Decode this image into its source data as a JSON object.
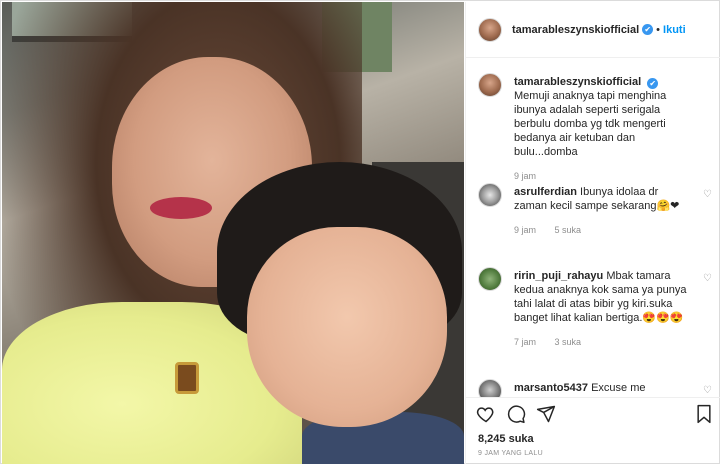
{
  "post": {
    "username": "tamarableszynskiofficial",
    "follow_label": "Ikuti",
    "separator": "•",
    "verified_mark": "✔"
  },
  "comments": [
    {
      "username": "tamarableszynskiofficial",
      "text": "Memuji anaknya tapi menghina ibunya adalah seperti serigala berbulu domba yg tdk mengerti bedanya air ketuban dan bulu...domba",
      "age": "9 jam",
      "likes": ""
    },
    {
      "username": "asrulferdian",
      "text": "Ibunya idolaa dr zaman kecil sampe sekarang🤗❤",
      "age": "9 jam",
      "likes": "5 suka"
    },
    {
      "username": "ririn_puji_rahayu",
      "text": "Mbak tamara kedua anaknya kok sama ya punya tahi lalat di atas bibir yg kiri.suka banget lihat kalian bertiga.😍😍😍",
      "age": "7 jam",
      "likes": "3 suka"
    },
    {
      "username": "marsanto5437",
      "text": "Excuse me",
      "age": "",
      "likes": ""
    }
  ],
  "footer": {
    "likes_count": "8,245 suka",
    "timestamp": "9 JAM YANG LALU"
  },
  "icons": {
    "like": "heart-icon",
    "comment": "comment-icon",
    "share": "share-icon",
    "save": "bookmark-icon",
    "comment_like": "small-heart-icon"
  },
  "colors": {
    "accent": "#0095f6",
    "verified": "#3897f0",
    "muted": "#8e8e8e"
  }
}
